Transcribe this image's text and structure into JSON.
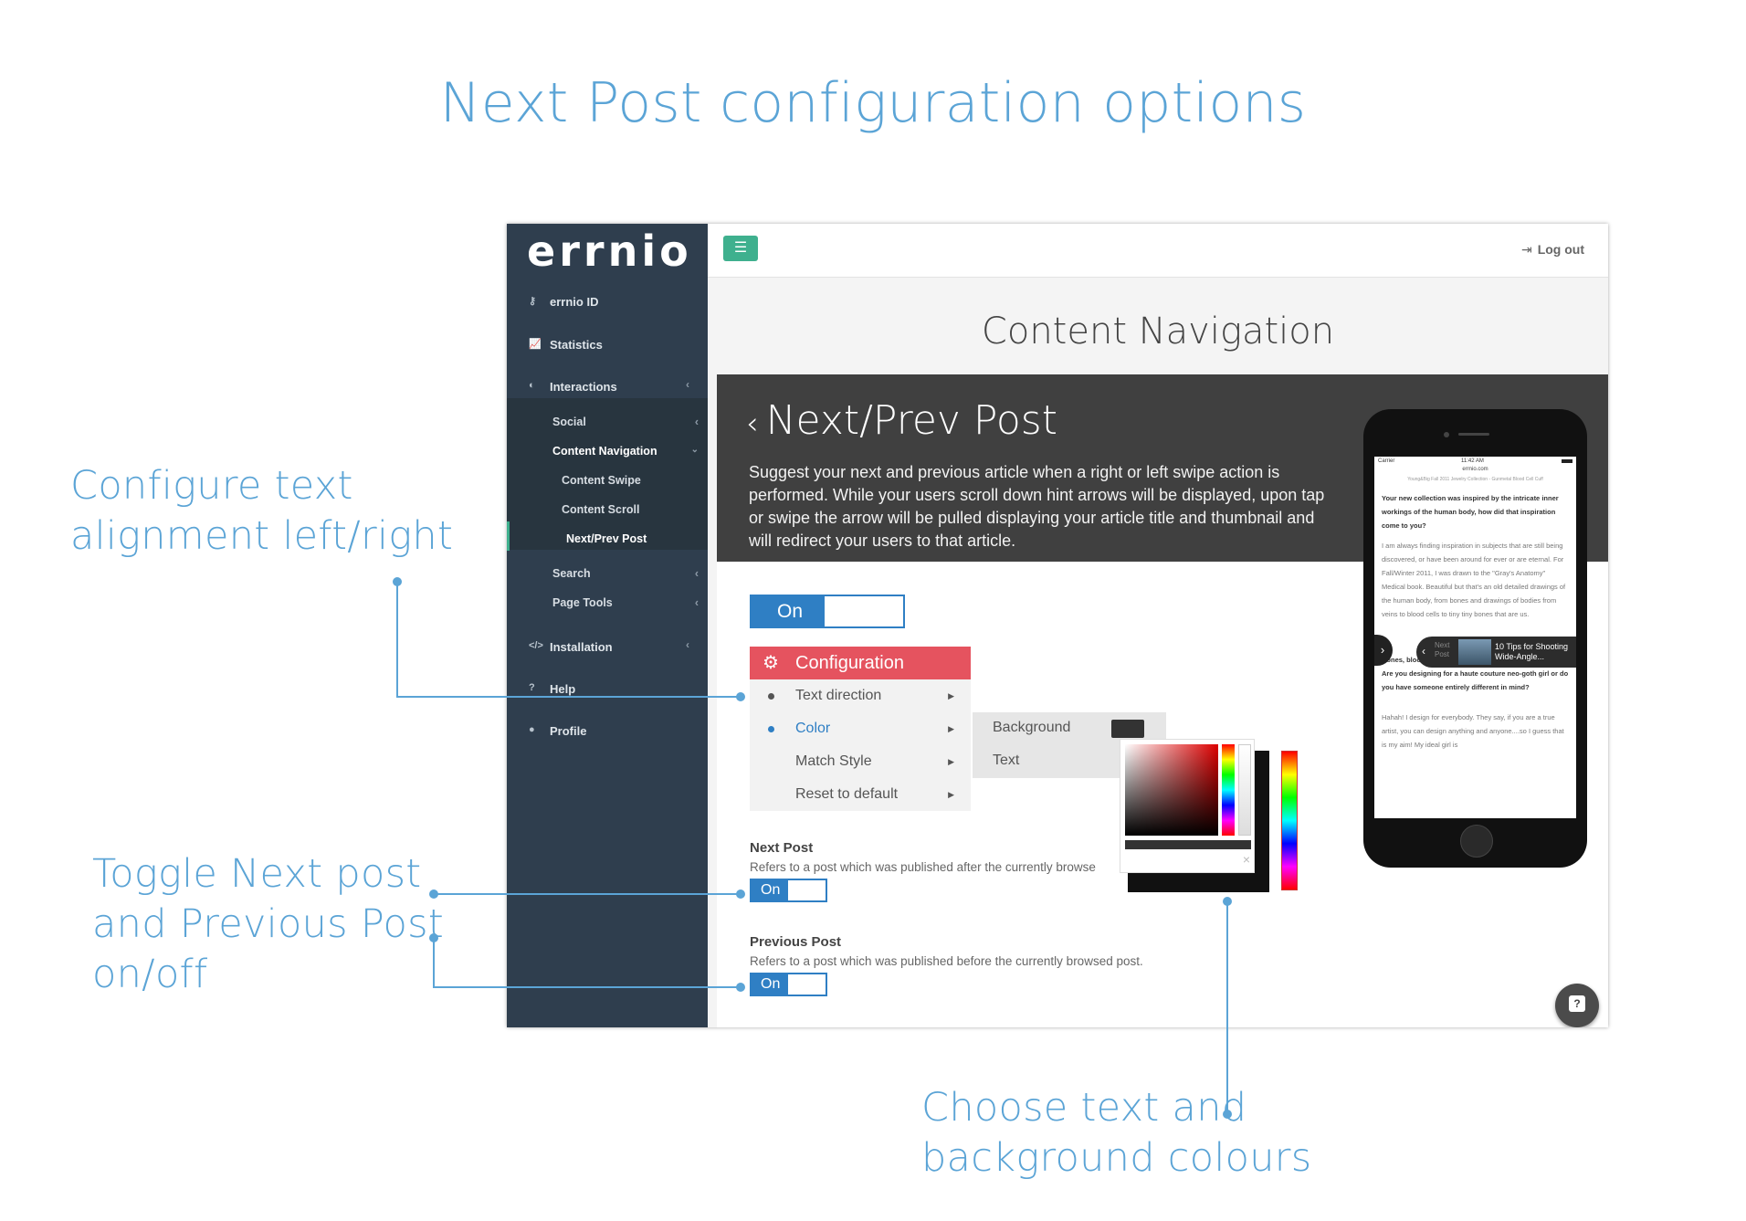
{
  "page_title": "Next Post configuration options",
  "callouts": {
    "alignment": [
      "Configure text",
      "alignment left/right"
    ],
    "toggle": [
      "Toggle Next post",
      "and Previous Post",
      "on/off"
    ],
    "colours": [
      "Choose text and",
      "background colours"
    ]
  },
  "app": {
    "logo": "errnio",
    "logout_label": "Log out",
    "sidebar": {
      "items": [
        {
          "label": "errnio ID",
          "icon": "key-icon"
        },
        {
          "label": "Statistics",
          "icon": "chart-icon"
        },
        {
          "label": "Interactions",
          "icon": "toggle-icon"
        },
        {
          "label": "Installation",
          "icon": "code-icon"
        },
        {
          "label": "Help",
          "icon": "help-icon"
        },
        {
          "label": "Profile",
          "icon": "user-icon"
        }
      ],
      "sub_items": [
        {
          "label": "Social"
        },
        {
          "label": "Content Navigation"
        },
        {
          "label": "Content Swipe"
        },
        {
          "label": "Content Scroll"
        },
        {
          "label": "Next/Prev Post"
        },
        {
          "label": "Search"
        },
        {
          "label": "Page Tools"
        }
      ]
    },
    "content_title": "Content Navigation",
    "panel": {
      "title": "Next/Prev Post",
      "back_glyph": "‹",
      "description": "Suggest your next and previous article when a right or left swipe action is performed. While your users scroll down hint arrows will be displayed, upon tap or swipe the arrow will be pulled displaying your article title and thumbnail and will redirect your users to that article."
    },
    "main_toggle": "On",
    "configuration": {
      "label": "Configuration",
      "items": [
        "Text direction",
        "Color",
        "Match Style",
        "Reset to default"
      ],
      "active_item": "Color",
      "color_submenu": [
        "Background",
        "Text"
      ],
      "background_color": "#333333"
    },
    "next_post": {
      "title": "Next Post",
      "description": "Refers to a post which was published after the currently browse",
      "toggle": "On"
    },
    "previous_post": {
      "title": "Previous Post",
      "description": "Refers to a post which was published before the currently browsed post.",
      "toggle": "On"
    },
    "phone": {
      "carrier": "Carrier",
      "time": "11:42 AM",
      "url": "errnio.com",
      "caption": "Young&Big Fall 2011 Jewelry Collection - Gunmetal Blood Cell Cuff",
      "paragraphs": [
        "Your new collection was inspired by the intricate inner workings of the human body, how did that inspiration come to you?",
        "I am always finding inspiration in subjects that are still being discovered, or have been around for ever or are eternal. For Fall/Winter 2011, I was drawn to the \"Gray's Anatomy\" Medical book. Beautiful but that's an old detailed drawings of the human body, from bones and drawings of bodies from veins to blood cells to tiny tiny bones that are us.",
        "Bones, blood, skeletal structures – these are quite edgy! Are you designing for a haute couture neo-goth girl or do you have someone entirely different in mind?",
        "Hahah! I design for everybody. They say, if you are a true artist, you can design anything and anyone....so I guess that is my aim! My ideal girl is"
      ],
      "next_label": "Next Post",
      "next_title": "10 Tips for Shooting Wide-Angle..."
    }
  },
  "colors": {
    "accent": "#5ba4d6",
    "sidebar": "#2f3e4e",
    "green": "#3fb08e",
    "config_red": "#e5535f",
    "toggle_blue": "#2f7fc4"
  }
}
